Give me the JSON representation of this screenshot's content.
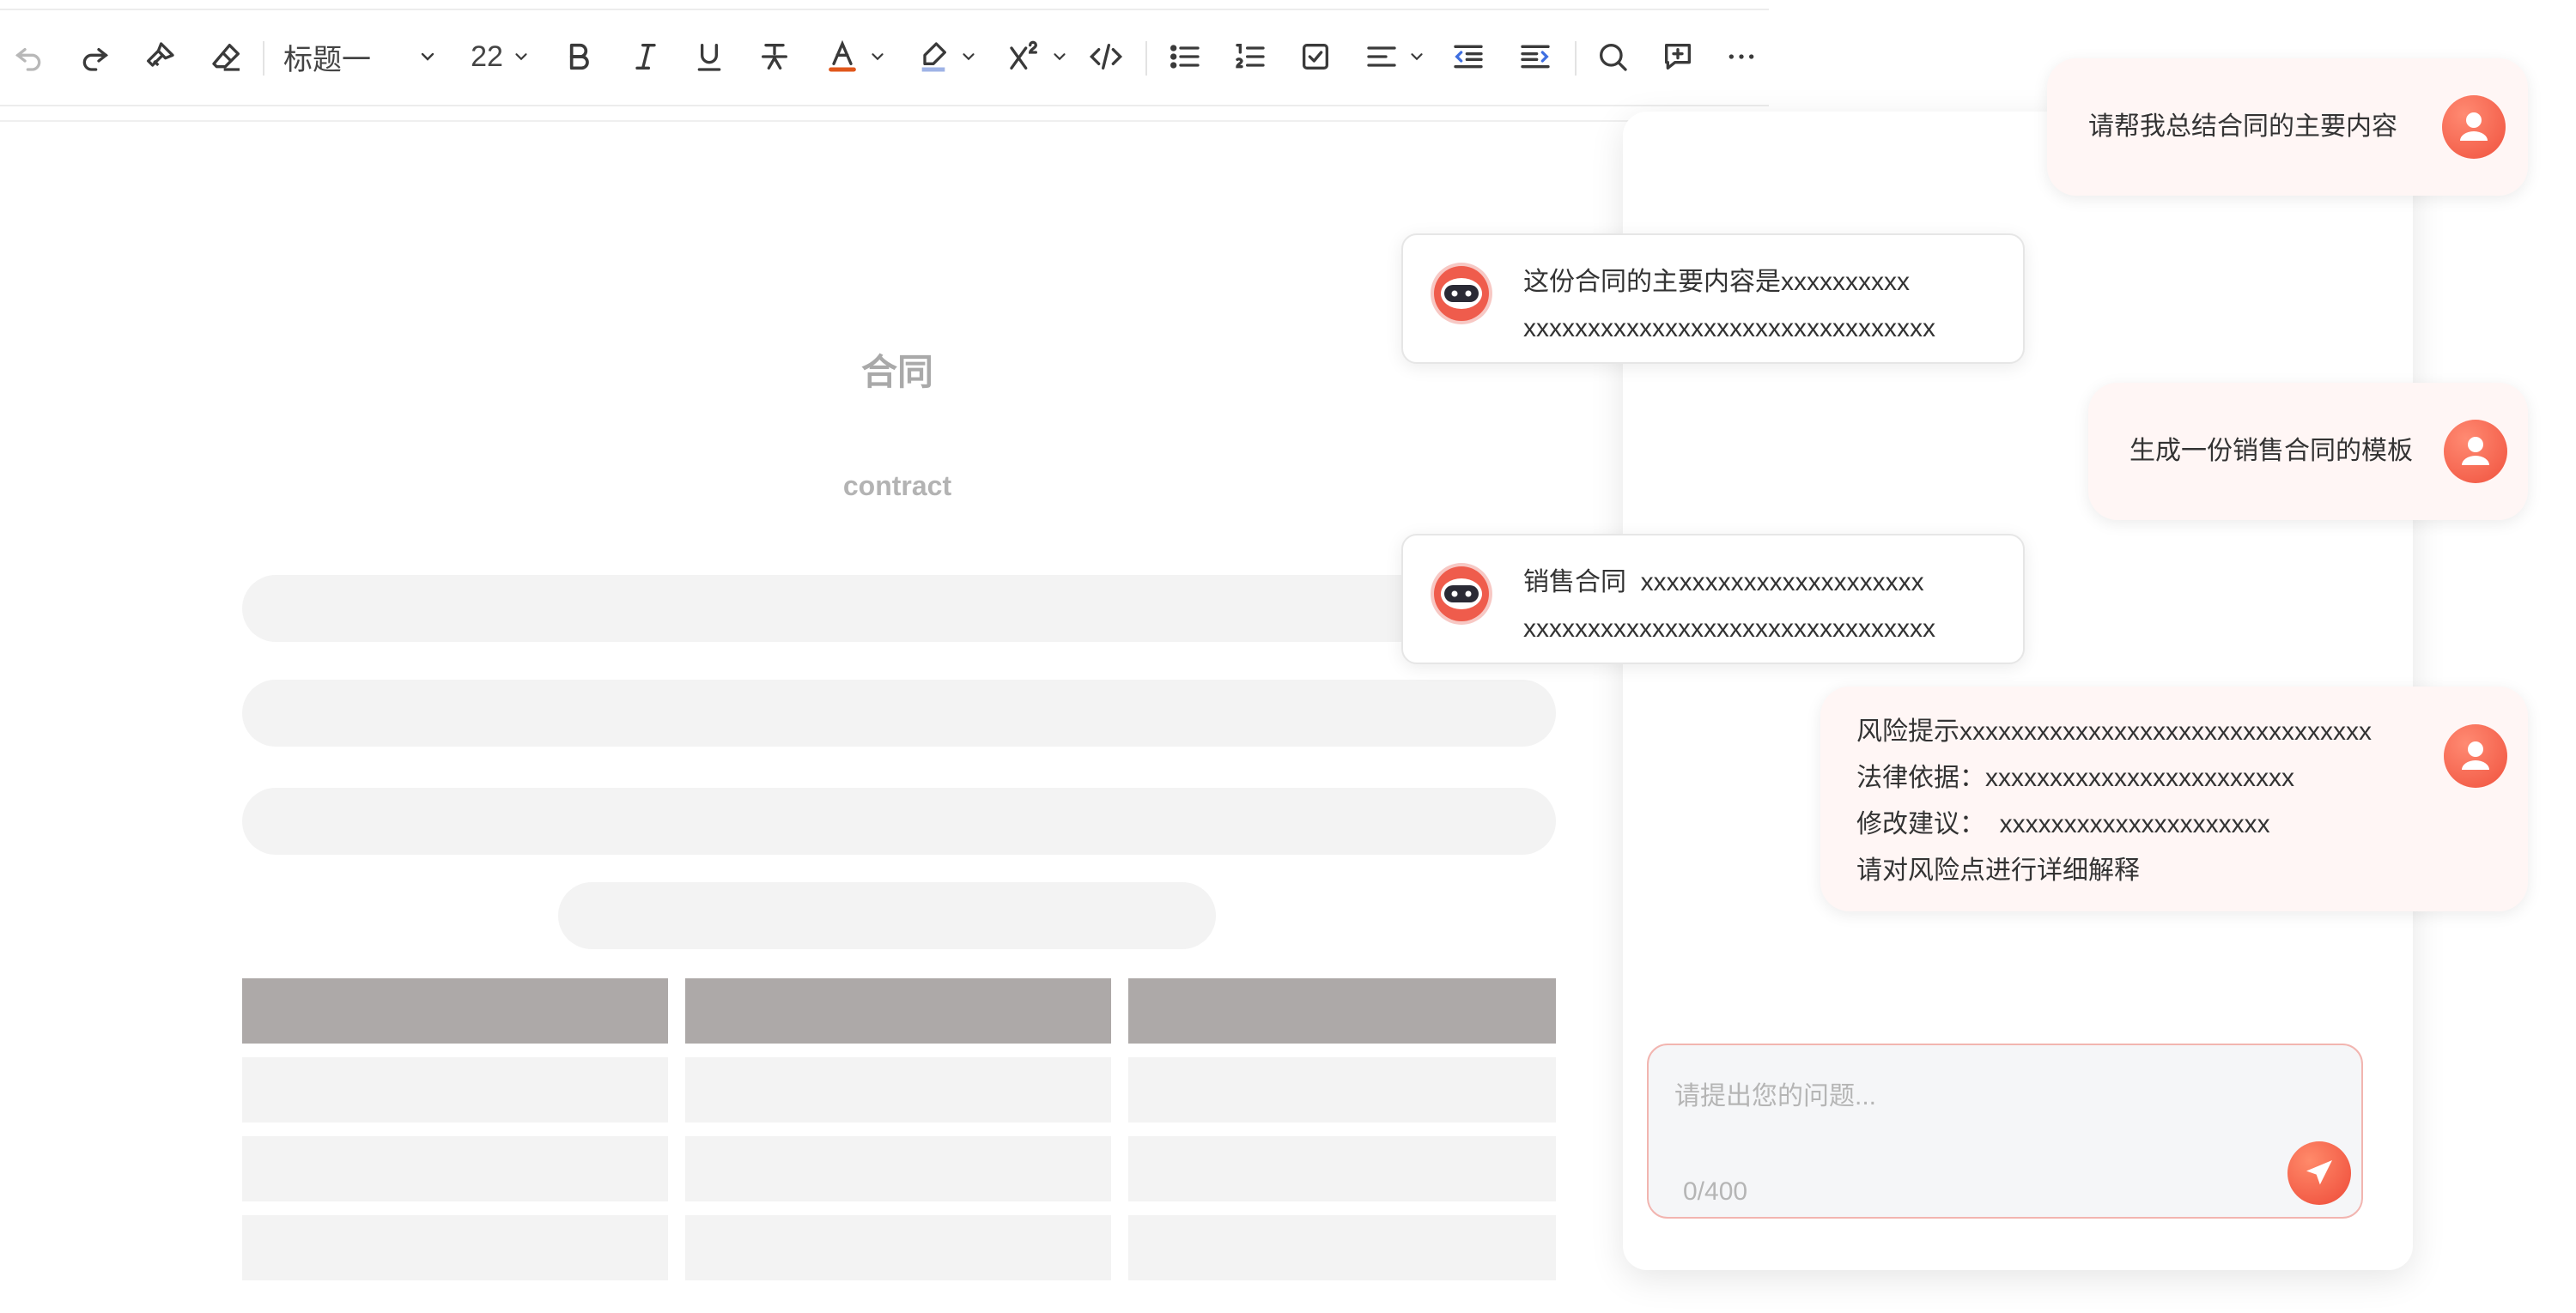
{
  "toolbar": {
    "heading_select": "标题一",
    "font_size": "22"
  },
  "document": {
    "title": "合同",
    "subtitle": "contract"
  },
  "chat": {
    "messages": [
      {
        "role": "user",
        "lines": [
          "请帮我总结合同的主要内容"
        ]
      },
      {
        "role": "assistant",
        "lines": [
          "这份合同的主要内容是xxxxxxxxxx",
          "xxxxxxxxxxxxxxxxxxxxxxxxxxxxxxxx"
        ]
      },
      {
        "role": "user",
        "lines": [
          "生成一份销售合同的模板"
        ]
      },
      {
        "role": "assistant",
        "lines": [
          "销售合同  xxxxxxxxxxxxxxxxxxxxxx",
          "xxxxxxxxxxxxxxxxxxxxxxxxxxxxxxxx"
        ]
      },
      {
        "role": "user",
        "lines": [
          "风险提示xxxxxxxxxxxxxxxxxxxxxxxxxxxxxxxx",
          "法律依据：xxxxxxxxxxxxxxxxxxxxxxxx",
          "修改建议：  xxxxxxxxxxxxxxxxxxxxx",
          "请对风险点进行详细解释"
        ]
      }
    ],
    "input": {
      "placeholder": "请提出您的问题...",
      "value": "",
      "counter": "0/400"
    }
  },
  "colors": {
    "accent": "#f0523e",
    "user_bubble": "#fff6f5",
    "table_header": "#ada9a8",
    "skeleton": "#f3f3f3"
  },
  "icons": [
    "undo-icon",
    "redo-icon",
    "format-painter-icon",
    "eraser-icon",
    "bold-icon",
    "italic-icon",
    "underline-icon",
    "strikethrough-icon",
    "font-color-icon",
    "highlight-icon",
    "superscript-icon",
    "code-icon",
    "bullet-list-icon",
    "numbered-list-icon",
    "checklist-icon",
    "align-icon",
    "outdent-icon",
    "indent-icon",
    "search-icon",
    "comment-icon",
    "more-icon",
    "user-avatar-icon",
    "bot-avatar-icon",
    "send-icon"
  ]
}
